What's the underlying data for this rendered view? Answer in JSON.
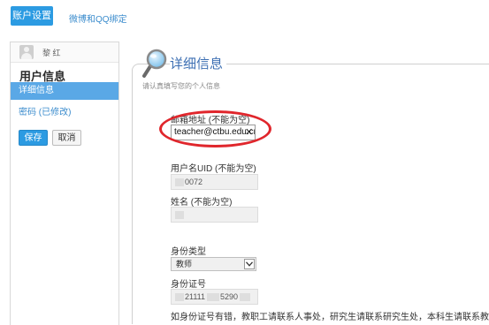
{
  "top_tabs": {
    "account_settings": "账户设置",
    "weibo_qq_binding": "微博和QQ绑定"
  },
  "sidebar": {
    "user_name": "黎 红",
    "heading": "用户信息",
    "active_item": "详细信息",
    "password_link": "密码 (已修改)",
    "save_label": "保存",
    "cancel_label": "取消"
  },
  "panel": {
    "title": "详细信息",
    "subtitle": "请认真填写您的个人信息"
  },
  "form": {
    "email_label": "邮箱地址 (不能为空)",
    "email_value": "teacher@ctbu.edu.cn",
    "uid_label": "用户名UID (不能为空)",
    "uid_value": "0072",
    "name_label": "姓名 (不能为空)",
    "identity_type_label": "身份类型",
    "identity_type_value": "教师",
    "id_number_label": "身份证号",
    "id_number_prefix": "21111",
    "id_number_middle": "5290",
    "note": "如身份证号有错，教职工请联系人事处，研究生请联系研究生处，本科生请联系教务处"
  },
  "icons": {
    "magnifier": "magnifier-icon",
    "avatar": "avatar-icon",
    "clear": "clear-x-icon",
    "dropdown": "chevron-down-icon"
  },
  "colors": {
    "accent": "#2c9be2",
    "highlight_ellipse": "#e0262c",
    "title": "#3d6fb3"
  }
}
